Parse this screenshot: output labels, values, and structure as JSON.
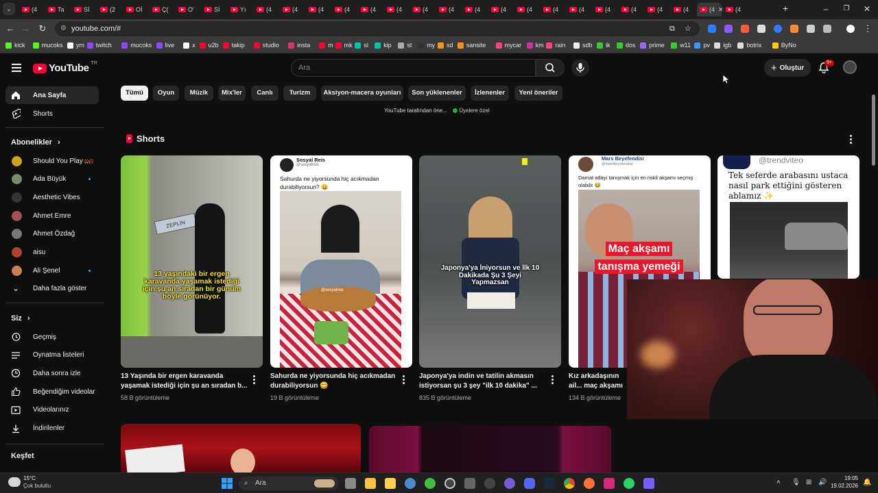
{
  "browser": {
    "tabs": [
      "(4",
      "Ta",
      "Sİ",
      "(2",
      "Oİ",
      "Ç(",
      "O'",
      "Sİ",
      "Yı",
      "(4",
      "(4",
      "(4",
      "(4",
      "(4",
      "(4",
      "(4",
      "(4",
      "(4",
      "(4",
      "(4",
      "(4",
      "(4",
      "(4",
      "(4",
      "(4",
      "(4",
      "(4",
      "(4"
    ],
    "new_tab": "+",
    "url": "youtube.com/#",
    "bookmarks": [
      {
        "label": "kick",
        "color": "#53fc18"
      },
      {
        "label": "mucoks",
        "color": "#53fc18"
      },
      {
        "label": "ym",
        "color": "#ffffff"
      },
      {
        "label": "twitch",
        "color": "#9146ff"
      },
      {
        "label": "mucoks",
        "color": "#9146ff"
      },
      {
        "label": "live",
        "color": "#9146ff"
      },
      {
        "label": "x",
        "color": "#ffffff"
      },
      {
        "label": "u2b",
        "color": "#ff0033"
      },
      {
        "label": "takip",
        "color": "#ff0033"
      },
      {
        "label": "studio",
        "color": "#ff0033"
      },
      {
        "label": "insta",
        "color": "#e1306c"
      },
      {
        "label": "m",
        "color": "#ff0033"
      },
      {
        "label": "mk",
        "color": "#ff0033"
      },
      {
        "label": "sl",
        "color": "#00c4a0"
      },
      {
        "label": "kip",
        "color": "#00c4a0"
      },
      {
        "label": "st",
        "color": "#aaaaaa"
      },
      {
        "label": "my",
        "color": "#333333"
      },
      {
        "label": "sd",
        "color": "#f7931a"
      },
      {
        "label": "sansite",
        "color": "#f7931a"
      },
      {
        "label": "mycar",
        "color": "#ff4081"
      },
      {
        "label": "km",
        "color": "#cc33aa"
      },
      {
        "label": "rain",
        "color": "#ff4081"
      },
      {
        "label": "sdb",
        "color": "#eeeeee"
      },
      {
        "label": "ik",
        "color": "#33cc33"
      },
      {
        "label": "dos",
        "color": "#33cc33"
      },
      {
        "label": "prime",
        "color": "#9966ff"
      },
      {
        "label": "w11",
        "color": "#33cc33"
      },
      {
        "label": "pv",
        "color": "#3399ff"
      },
      {
        "label": "igb",
        "color": "#dddddd"
      },
      {
        "label": "botrix",
        "color": "#dddddd"
      },
      {
        "label": "ByNo",
        "color": "#ffcc00"
      }
    ]
  },
  "header": {
    "logo": "YouTube",
    "country_code": "TR",
    "search_placeholder": "Ara",
    "create_label": "Oluştur",
    "notif_badge": "9+"
  },
  "sidebar": {
    "top": [
      {
        "label": "Ana Sayfa",
        "icon": "home-icon"
      },
      {
        "label": "Shorts",
        "icon": "shorts-icon"
      }
    ],
    "subs_header": "Abonelikler",
    "subs": [
      {
        "label": "Should You Play ...",
        "color": "#d4a017",
        "indicator": "live"
      },
      {
        "label": "Ada Büyük",
        "color": "#7a8a6a",
        "indicator": "dot"
      },
      {
        "label": "Aesthetic Vibes",
        "color": "#333333",
        "indicator": ""
      },
      {
        "label": "Ahmet Emre",
        "color": "#a85050",
        "indicator": ""
      },
      {
        "label": "Ahmet Özdağ",
        "color": "#777777",
        "indicator": ""
      },
      {
        "label": "aisu",
        "color": "#b04030",
        "indicator": ""
      },
      {
        "label": "Ali Şenel",
        "color": "#d08050",
        "indicator": "dot"
      }
    ],
    "show_more": "Daha fazla göster",
    "you_header": "Siz",
    "you": [
      {
        "label": "Geçmiş",
        "icon": "history-icon"
      },
      {
        "label": "Oynatma listeleri",
        "icon": "playlists-icon"
      },
      {
        "label": "Daha sonra izle",
        "icon": "watch-later-icon"
      },
      {
        "label": "Beğendiğim videolar",
        "icon": "like-icon"
      },
      {
        "label": "Videolarınız",
        "icon": "your-videos-icon"
      },
      {
        "label": "İndirilenler",
        "icon": "download-icon"
      }
    ],
    "explore_header": "Keşfet"
  },
  "chips": [
    "Tümü",
    "Oyun",
    "Müzik",
    "Mix'ler",
    "Canlı",
    "Turizm",
    "Aksiyon-macera oyunları",
    "Son yüklenenler",
    "İzlenenler",
    "Yeni öneriler"
  ],
  "chip_row2": {
    "text": "YouTube tarafından öne...",
    "members": "Üyelere özel"
  },
  "shorts": {
    "title": "Shorts",
    "items": [
      {
        "title": "13 Yaşında bir ergen karavanda yaşamak istediği için şu an sıradan b...",
        "views": "58 B görüntüleme",
        "caption": "13 yaşındaki bir ergen karavanda yaşamak istediği için şu an sıradan bir günüm böyle görünüyor.",
        "sign": "ZEPLIN"
      },
      {
        "title": "Sahurda ne yiyorsunda hiç acıkmadan durabiliyorsun 😋",
        "views": "19 B görüntüleme",
        "channel": "Sosyal Reis",
        "handle": "@sosyalreis",
        "post": "Sahurda ne yiyorsunda hiç acıkmadan durabiliyorsun? 😀",
        "watermark": "@sosyalreis"
      },
      {
        "title": "Japonya'ya indin ve tatilin akmasın istiyorsan şu 3 şey \"ilk 10 dakika\" ...",
        "views": "835 B görüntüleme",
        "caption": "Japonya'ya İniyorsun ve İlk 10 Dakikada Şu 3 Şeyi Yapmazsan"
      },
      {
        "title": "Kız arkadaşının ail... maç akşamı gelen...",
        "views": "134 B görüntüleme",
        "channel": "Mars Beyefendisi",
        "handle": "@marsbeyefendisi",
        "post": "Damat adayı tanışmak için en riskli akşamı seçmiş olabilir 😂",
        "caption": "Maç akşamı tanışma yemeği"
      },
      {
        "handle": "@trendviteo",
        "post": "Tek seferde arabasını ustaca nasıl park ettiğini gösteren ablamız ✨"
      }
    ]
  },
  "taskbar": {
    "weather_temp": "15°C",
    "weather_desc": "Çok bulutlu",
    "search": "Ara",
    "time": "19:05",
    "date": "19.02.2026"
  }
}
